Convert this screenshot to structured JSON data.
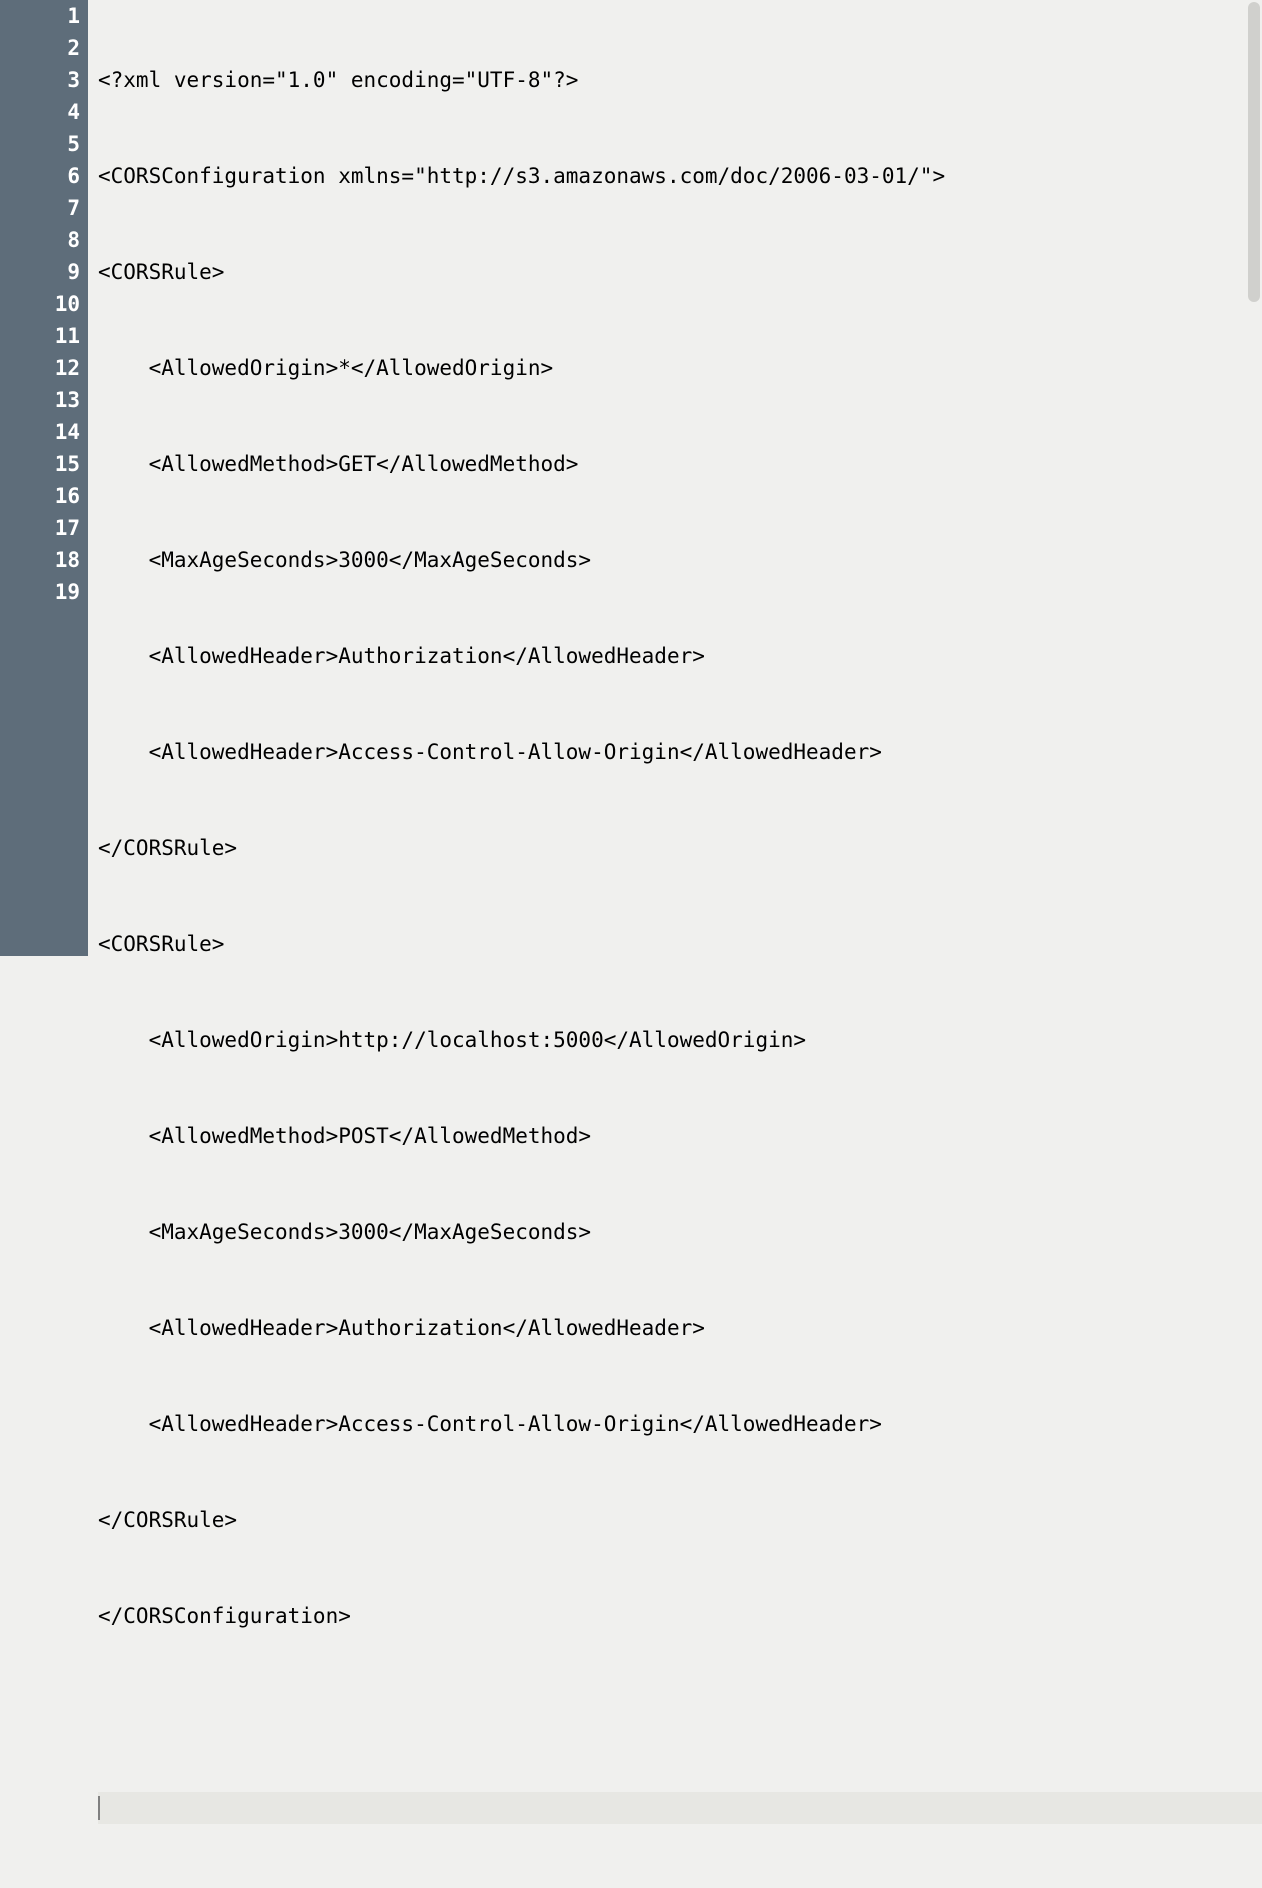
{
  "editor": {
    "total_lines": 19,
    "cursor_line": 19,
    "lines": [
      "<?xml version=\"1.0\" encoding=\"UTF-8\"?>",
      "<CORSConfiguration xmlns=\"http://s3.amazonaws.com/doc/2006-03-01/\">",
      "<CORSRule>",
      "    <AllowedOrigin>*</AllowedOrigin>",
      "    <AllowedMethod>GET</AllowedMethod>",
      "    <MaxAgeSeconds>3000</MaxAgeSeconds>",
      "    <AllowedHeader>Authorization</AllowedHeader>",
      "    <AllowedHeader>Access-Control-Allow-Origin</AllowedHeader>",
      "</CORSRule>",
      "<CORSRule>",
      "    <AllowedOrigin>http://localhost:5000</AllowedOrigin>",
      "    <AllowedMethod>POST</AllowedMethod>",
      "    <MaxAgeSeconds>3000</MaxAgeSeconds>",
      "    <AllowedHeader>Authorization</AllowedHeader>",
      "    <AllowedHeader>Access-Control-Allow-Origin</AllowedHeader>",
      "</CORSRule>",
      "</CORSConfiguration>",
      "",
      ""
    ],
    "line_numbers": [
      "1",
      "2",
      "3",
      "4",
      "5",
      "6",
      "7",
      "8",
      "9",
      "10",
      "11",
      "12",
      "13",
      "14",
      "15",
      "16",
      "17",
      "18",
      "19"
    ]
  }
}
